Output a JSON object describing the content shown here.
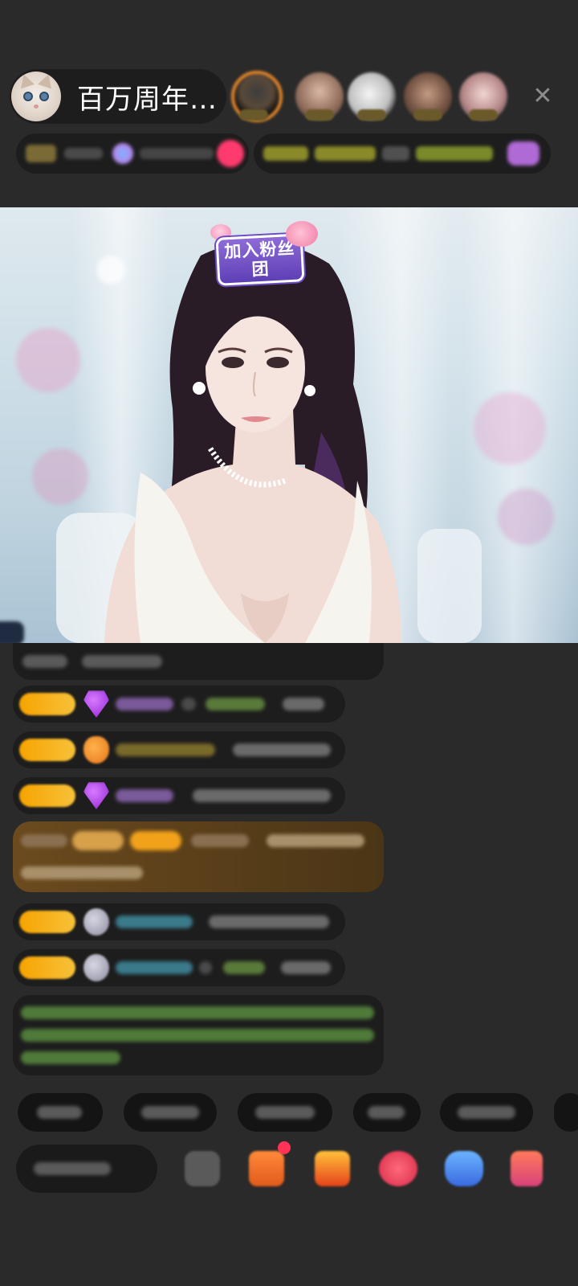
{
  "header": {
    "host_name": "百万周年…",
    "close_glyph": "✕",
    "viewers": [
      "viewer-1",
      "viewer-2",
      "viewer-3",
      "viewer-4",
      "viewer-5"
    ]
  },
  "video": {
    "badge_text": "加入粉丝团"
  },
  "colors": {
    "background": "#2a2a2a",
    "panel": "#1d1d1d",
    "level_badge": "#f6a400",
    "highlight_card": "#6b4a1e",
    "accent_viewer_ring": "#e4862a",
    "notice_text": "#8fd06b"
  },
  "icons": [
    "cat-avatar-icon",
    "close-icon",
    "diamond-gem-icon",
    "fan-shield-icon",
    "cloud-icon",
    "emoji-icon",
    "gift-box-icon",
    "red-packet-icon",
    "game-icon",
    "shop-icon"
  ]
}
